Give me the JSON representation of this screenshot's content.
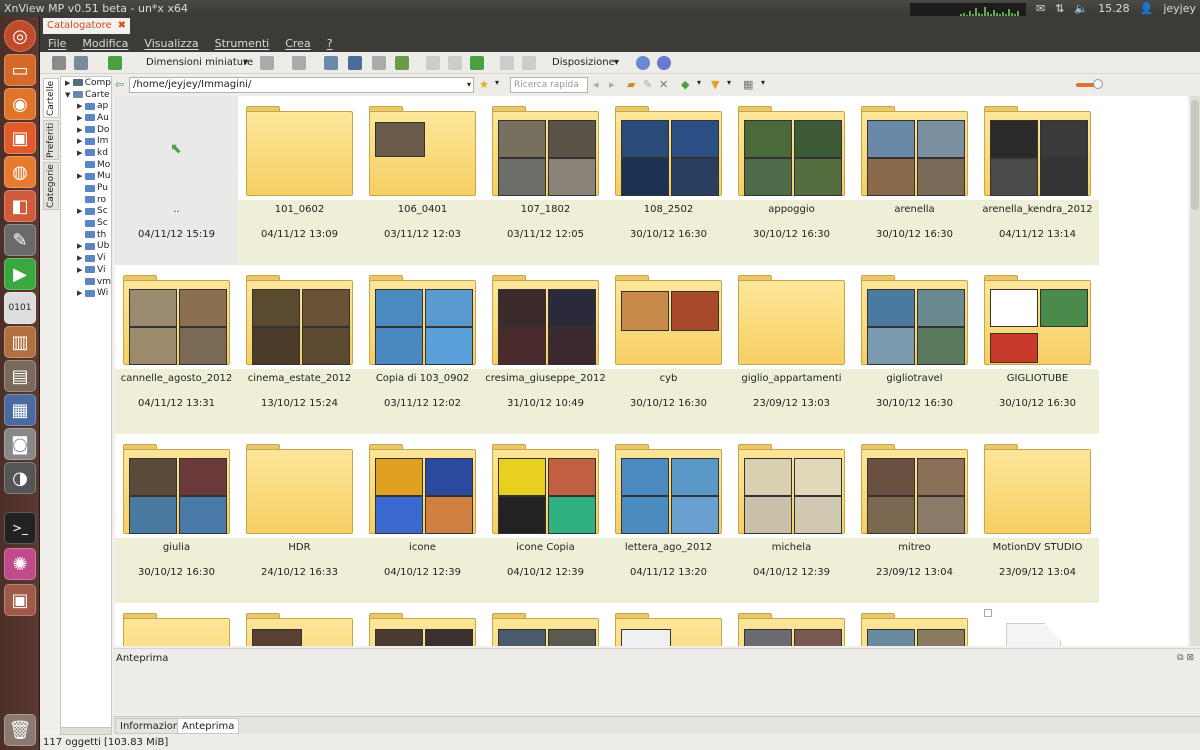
{
  "window": {
    "title": "XnView MP v0.51 beta - un*x x64"
  },
  "topbar": {
    "time": "15.28",
    "user": "jeyjey"
  },
  "tab": {
    "label": "Catalogatore"
  },
  "menu": [
    "File",
    "Modifica",
    "Visualizza",
    "Strumenti",
    "Crea",
    "?"
  ],
  "toolbar": {
    "thumb_size_label": "Dimensioni miniature",
    "layout_label": "Disposizione"
  },
  "sidetabs": [
    "Cartelle",
    "Preferiti",
    "Categorie"
  ],
  "tree": [
    {
      "label": "Comp",
      "arrow": "▶",
      "color": "#5b6a7a"
    },
    {
      "label": "Carte",
      "arrow": "▼",
      "color": "#6b88aa"
    },
    {
      "label": "ap",
      "arrow": "▶",
      "color": "#5b86c6"
    },
    {
      "label": "Au",
      "arrow": "▶",
      "color": "#5b86c6"
    },
    {
      "label": "Do",
      "arrow": "▶",
      "color": "#5b86c6"
    },
    {
      "label": "Im",
      "arrow": "▶",
      "color": "#5b86c6"
    },
    {
      "label": "kd",
      "arrow": "▶",
      "color": "#5b86c6"
    },
    {
      "label": "Mo",
      "arrow": "",
      "color": "#5b86c6"
    },
    {
      "label": "Mu",
      "arrow": "▶",
      "color": "#5b86c6"
    },
    {
      "label": "Pu",
      "arrow": "",
      "color": "#5b86c6"
    },
    {
      "label": "ro",
      "arrow": "",
      "color": "#5b86c6"
    },
    {
      "label": "Sc",
      "arrow": "▶",
      "color": "#5b86c6"
    },
    {
      "label": "Sc",
      "arrow": "",
      "color": "#5b86c6"
    },
    {
      "label": "th",
      "arrow": "",
      "color": "#5b86c6"
    },
    {
      "label": "Ub",
      "arrow": "▶",
      "color": "#5b86c6"
    },
    {
      "label": "Vi",
      "arrow": "▶",
      "color": "#5b86c6"
    },
    {
      "label": "Vi",
      "arrow": "▶",
      "color": "#5b86c6"
    },
    {
      "label": "vm",
      "arrow": "",
      "color": "#5b86c6"
    },
    {
      "label": "Wi",
      "arrow": "▶",
      "color": "#5b86c6"
    }
  ],
  "address": {
    "path": "/home/jeyjey/Immagini/",
    "search_placeholder": "Ricerca rapida"
  },
  "items": [
    {
      "name": "..",
      "date": "04/11/12 15:19",
      "kind": "up",
      "pics": []
    },
    {
      "name": "101_0602",
      "date": "04/11/12 13:09",
      "kind": "folder",
      "pics": []
    },
    {
      "name": "106_0401",
      "date": "03/11/12 12:03",
      "kind": "folder",
      "pics": [
        "#6a5a4a"
      ]
    },
    {
      "name": "107_1802",
      "date": "03/11/12 12:05",
      "kind": "folder",
      "pics": [
        "#77705e",
        "#5a5348",
        "#6c6e68",
        "#8a8478"
      ]
    },
    {
      "name": "108_2502",
      "date": "30/10/12 16:30",
      "kind": "folder",
      "pics": [
        "#2a4a7a",
        "#2b4f84",
        "#1c3154",
        "#2a3f60"
      ]
    },
    {
      "name": "appoggio",
      "date": "30/10/12 16:30",
      "kind": "folder",
      "pics": [
        "#4a6a3a",
        "#3c5a34",
        "#4e6a48",
        "#556d3f"
      ]
    },
    {
      "name": "arenella",
      "date": "30/10/12 16:30",
      "kind": "folder",
      "pics": [
        "#6a88a8",
        "#7a90a0",
        "#8a6a4a",
        "#7a6a58"
      ]
    },
    {
      "name": "arenella_kendra_2012",
      "date": "04/11/12 13:14",
      "kind": "folder",
      "pics": [
        "#2a2a2a",
        "#3a3a3a",
        "#4a4a4a",
        "#333"
      ]
    },
    {
      "name": "cannelle_agosto_2012",
      "date": "04/11/12 13:31",
      "kind": "folder",
      "pics": [
        "#9a8a70",
        "#8a7050",
        "#9c8a6c",
        "#7a6a55"
      ]
    },
    {
      "name": "cinema_estate_2012",
      "date": "13/10/12 15:24",
      "kind": "folder",
      "pics": [
        "#5a4a30",
        "#6a5238",
        "#4a3c28",
        "#5c4a30"
      ]
    },
    {
      "name": "Copia di 103_0902",
      "date": "03/11/12 12:02",
      "kind": "folder",
      "pics": [
        "#4a8ac0",
        "#5a9ad0",
        "#4a88c0",
        "#5aa0d8"
      ]
    },
    {
      "name": "cresima_giuseppe_2012",
      "date": "31/10/12 10:49",
      "kind": "folder",
      "pics": [
        "#3a2a2a",
        "#2a2a3a",
        "#4a2a2a",
        "#3a2a30"
      ]
    },
    {
      "name": "cyb",
      "date": "30/10/12 16:30",
      "kind": "folder",
      "pics": [
        "#c88a4a",
        "#a84a2a"
      ]
    },
    {
      "name": "giglio_appartamenti",
      "date": "23/09/12 13:03",
      "kind": "folder",
      "pics": []
    },
    {
      "name": "gigliotravel",
      "date": "30/10/12 16:30",
      "kind": "folder",
      "pics": [
        "#4a7aa0",
        "#6a8a90",
        "#7a9ab0",
        "#5a7a60"
      ]
    },
    {
      "name": "GIGLIOTUBE",
      "date": "30/10/12 16:30",
      "kind": "folder",
      "pics": [
        "#ffffff",
        "#4a8a4a",
        "#c83a2a"
      ]
    },
    {
      "name": "giulia",
      "date": "30/10/12 16:30",
      "kind": "folder",
      "pics": [
        "#5a4a3a",
        "#6a3a3a",
        "#4a7aa0",
        "#4a7aa8"
      ]
    },
    {
      "name": "HDR",
      "date": "24/10/12 16:33",
      "kind": "folder",
      "pics": []
    },
    {
      "name": "icone",
      "date": "04/10/12 12:39",
      "kind": "folder",
      "pics": [
        "#e0a020",
        "#2a4aa0",
        "#3a6ad0",
        "#d08040"
      ]
    },
    {
      "name": "icone Copia",
      "date": "04/10/12 12:39",
      "kind": "folder",
      "pics": [
        "#e8d020",
        "#c06040",
        "#222222",
        "#30b080"
      ]
    },
    {
      "name": "lettera_ago_2012",
      "date": "04/11/12 13:20",
      "kind": "folder",
      "pics": [
        "#4a8ac0",
        "#5a98c8",
        "#4a8cc0",
        "#6aa0d0"
      ]
    },
    {
      "name": "michela",
      "date": "04/10/12 12:39",
      "kind": "folder",
      "pics": [
        "#d8d0b0",
        "#e0d8b8",
        "#c8c0a8",
        "#d0c8b0"
      ]
    },
    {
      "name": "mitreo",
      "date": "23/09/12 13:04",
      "kind": "folder",
      "pics": [
        "#6a5040",
        "#8a7058",
        "#7a6850",
        "#8a7a68"
      ]
    },
    {
      "name": "MotionDV STUDIO",
      "date": "23/09/12 13:04",
      "kind": "folder",
      "pics": []
    },
    {
      "name": "",
      "date": "",
      "kind": "folder",
      "pics": []
    },
    {
      "name": "",
      "date": "",
      "kind": "folder",
      "pics": [
        "#5a4030"
      ]
    },
    {
      "name": "",
      "date": "",
      "kind": "folder",
      "pics": [
        "#4a3a30",
        "#3a3030"
      ]
    },
    {
      "name": "",
      "date": "",
      "kind": "folder",
      "pics": [
        "#4a5a6a",
        "#5a5a50"
      ]
    },
    {
      "name": "",
      "date": "",
      "kind": "folder",
      "pics": [
        "#f0f0f0"
      ]
    },
    {
      "name": "",
      "date": "",
      "kind": "folder",
      "pics": [
        "#6a6a70",
        "#7a5a50"
      ]
    },
    {
      "name": "",
      "date": "",
      "kind": "folder",
      "pics": [
        "#6a8aa0",
        "#8a7a60"
      ]
    },
    {
      "name": "",
      "date": "",
      "kind": "file",
      "pics": []
    }
  ],
  "preview": {
    "title": "Anteprima"
  },
  "bottom_tabs": [
    "Informazioni",
    "Anteprima"
  ],
  "status": "117 oggetti [103.83 MiB]"
}
